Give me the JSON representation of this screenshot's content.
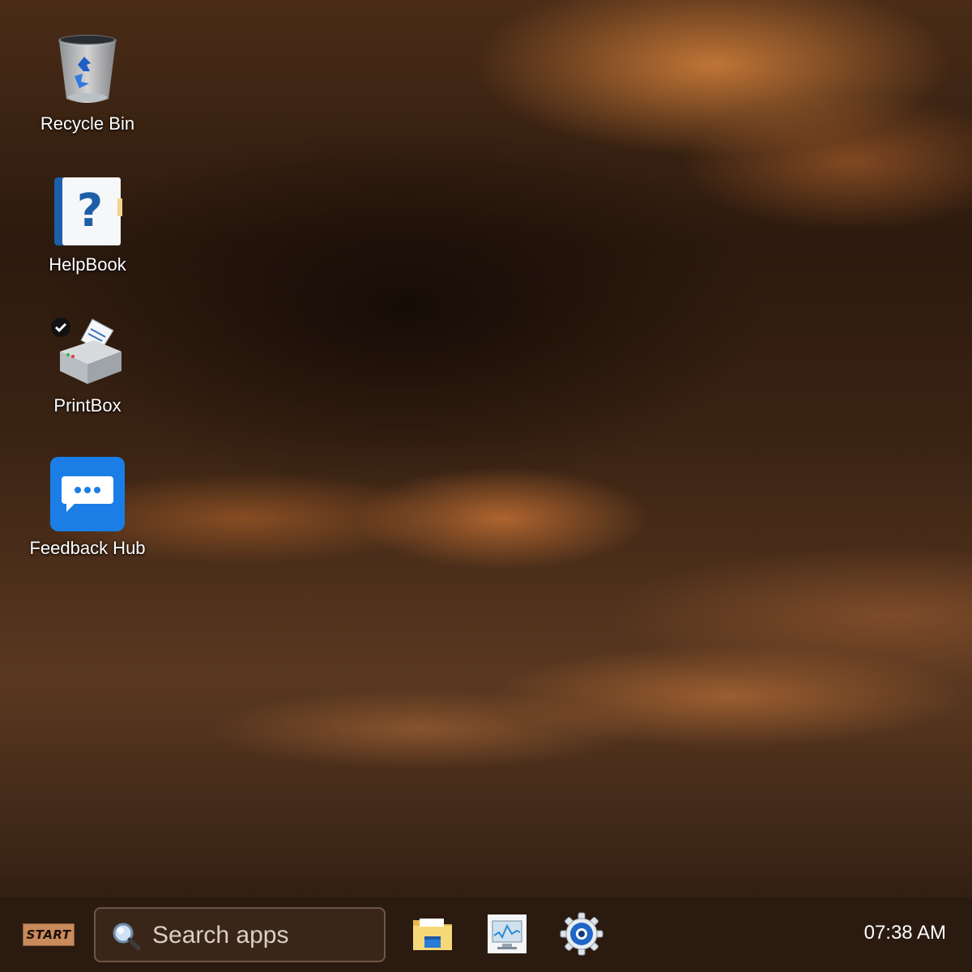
{
  "desktop": {
    "icons": [
      {
        "label": "Recycle Bin",
        "icon": "recycle-bin-icon"
      },
      {
        "label": "HelpBook",
        "icon": "help-book-icon"
      },
      {
        "label": "PrintBox",
        "icon": "printer-icon"
      },
      {
        "label": "Feedback Hub",
        "icon": "feedback-chat-icon"
      }
    ]
  },
  "taskbar": {
    "start_label": "START",
    "search": {
      "placeholder": "Search apps",
      "value": ""
    },
    "pinned_apps": [
      {
        "icon": "file-explorer-folder-icon"
      },
      {
        "icon": "system-monitor-icon"
      },
      {
        "icon": "settings-gear-icon"
      }
    ],
    "clock": "07:38 AM"
  },
  "colors": {
    "taskbar_bg": "#2b1a10",
    "start_bg": "#c98a5c",
    "feedback_blue": "#1a7ee6"
  }
}
